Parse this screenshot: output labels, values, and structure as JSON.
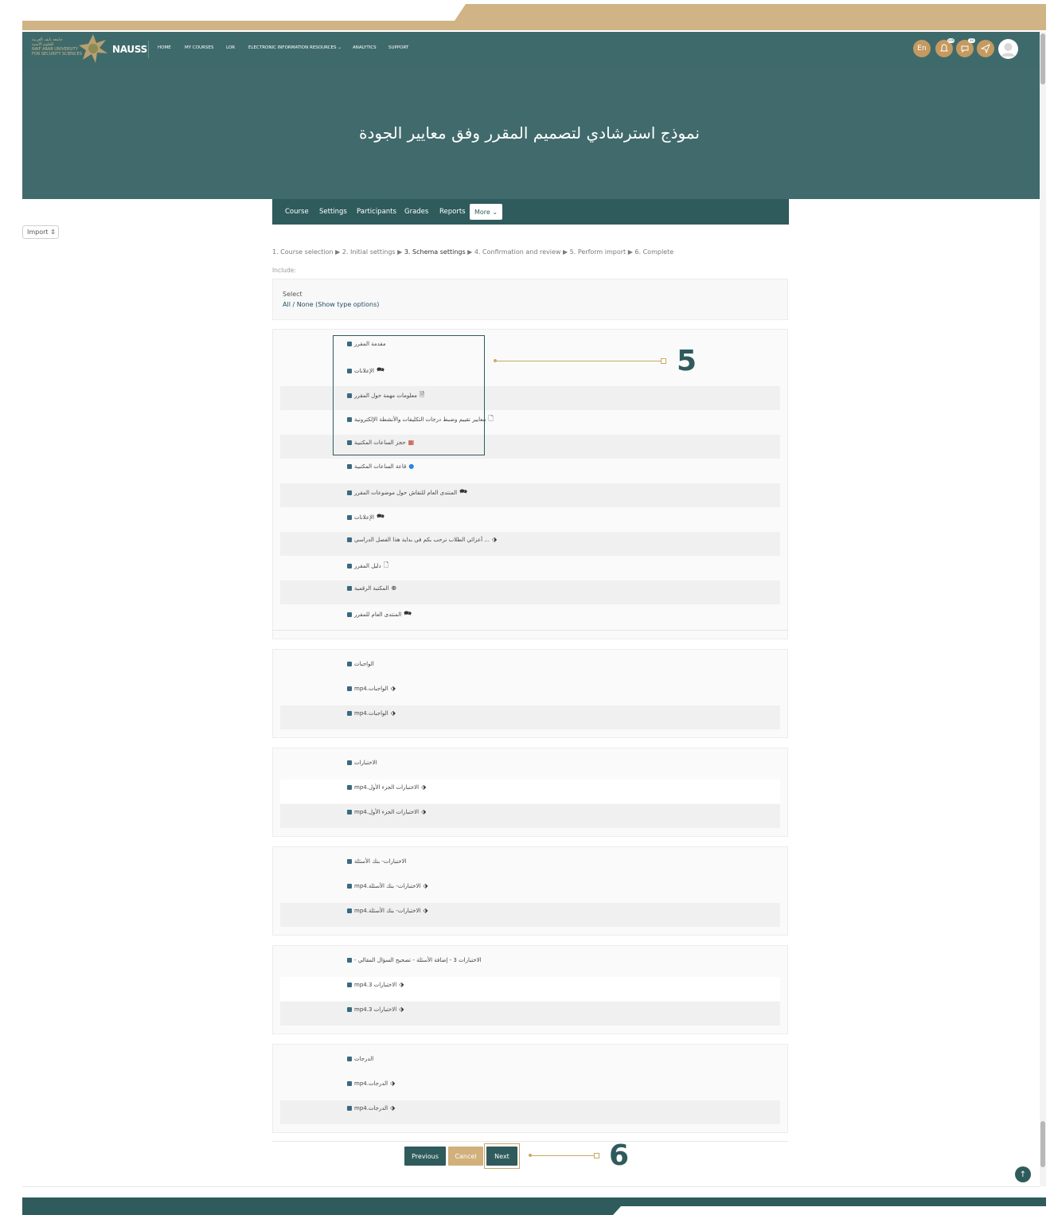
{
  "navbar": {
    "logo_lines": [
      "جامعة نايف العربية",
      "للعلوم الأمنية",
      "NAIF ARAB UNIVERSITY",
      "FOR SECURITY SCIENCES"
    ],
    "brand": "NAUSS",
    "items": [
      "HOME",
      "MY COURSES",
      "LOR",
      "ELECTRONIC INFORMATION RESOURCES ⌄",
      "ANALYTICS",
      "SUPPORT"
    ],
    "lang": "En",
    "badge1": "100",
    "badge2": "32",
    "icons": [
      "bell-icon",
      "chat-icon",
      "send-icon",
      "avatar"
    ]
  },
  "hero": {
    "title": "نموذج استرشادي لتصميم المقرر وفق معايير الجودة"
  },
  "course_nav": {
    "items": [
      "Course",
      "Settings",
      "Participants",
      "Grades",
      "Reports"
    ],
    "more": "More ⌄"
  },
  "import_select": "Import ⇕",
  "steps": {
    "pre": "1. Course selection ▶ 2. Initial settings ▶ ",
    "current": "3. Schema settings",
    "post": " ▶ 4. Confirmation and review ▶ 5. Perform import ▶ 6. Complete"
  },
  "include_label": "Include:",
  "select": {
    "label": "Select",
    "links": "All / None (Show type options)"
  },
  "sections": [
    {
      "items": [
        {
          "text": "مقدمة المقرر",
          "icon": ""
        },
        {
          "text": "الإعلانات",
          "icon": "forum-icon"
        },
        {
          "text": "معلومات مهمة حول المقرر",
          "icon": "page-icon"
        },
        {
          "text": "معايير تقييم وضبط درجات التكليفات والأنشطة الإلكترونية",
          "icon": "file-icon"
        },
        {
          "text": "حجز الساعات المكتبية",
          "icon": "calendar-icon"
        },
        {
          "text": "قاعة الساعات المكتبية",
          "icon": "meeting-icon"
        },
        {
          "text": "المنتدى العام للنقاش حول موضوعات المقرر",
          "icon": "forum-icon"
        },
        {
          "text": "الإعلانات",
          "icon": "forum-icon"
        },
        {
          "text": "... أعزائي الطلاب نرحب بكم في بداية هذا الفصل الدراسي",
          "icon": "label-icon"
        },
        {
          "text": "دليل المقرر",
          "icon": "file-icon"
        },
        {
          "text": "المكتبة الرقمية",
          "icon": "globe-icon"
        },
        {
          "text": "المنتدى العام للمقرر",
          "icon": "forum-icon"
        }
      ]
    },
    {
      "items": [
        {
          "text": "الواجبات",
          "icon": ""
        },
        {
          "text": "الواجبات.mp4",
          "icon": "label-icon"
        },
        {
          "text": "الواجبات.mp4",
          "icon": "label-icon"
        }
      ]
    },
    {
      "items": [
        {
          "text": "الاختبارات",
          "icon": ""
        },
        {
          "text": "الاختبارات الجزء الأول.mp4",
          "icon": "label-icon"
        },
        {
          "text": "الاختبارات الجزء الأول.mp4",
          "icon": "label-icon"
        }
      ]
    },
    {
      "items": [
        {
          "text": "الاختبارات- بنك الأسئلة",
          "icon": ""
        },
        {
          "text": "الاختبارات- بنك الأسئلة.mp4",
          "icon": "label-icon"
        },
        {
          "text": "الاختبارات- بنك الأسئلة.mp4",
          "icon": "label-icon"
        }
      ]
    },
    {
      "items": [
        {
          "text": "الاختبارات 3 - إضافة الأسئلة - تصحيح السؤال المقالي -",
          "icon": ""
        },
        {
          "text": "الاختبارات 3.mp4",
          "icon": "label-icon"
        },
        {
          "text": "الاختبارات 3.mp4",
          "icon": "label-icon"
        }
      ]
    },
    {
      "items": [
        {
          "text": "الدرجات",
          "icon": ""
        },
        {
          "text": "الدرجات.mp4",
          "icon": "label-icon"
        },
        {
          "text": "الدرجات.mp4",
          "icon": "label-icon"
        }
      ]
    }
  ],
  "callouts": {
    "first": "5",
    "second": "6"
  },
  "buttons": {
    "previous": "Previous",
    "cancel": "Cancel",
    "next": "Next"
  },
  "to_top": "↑",
  "colors": {
    "teal": "#3f6a6b",
    "gold": "#d0b485",
    "checkbox": "#3a6a82"
  }
}
